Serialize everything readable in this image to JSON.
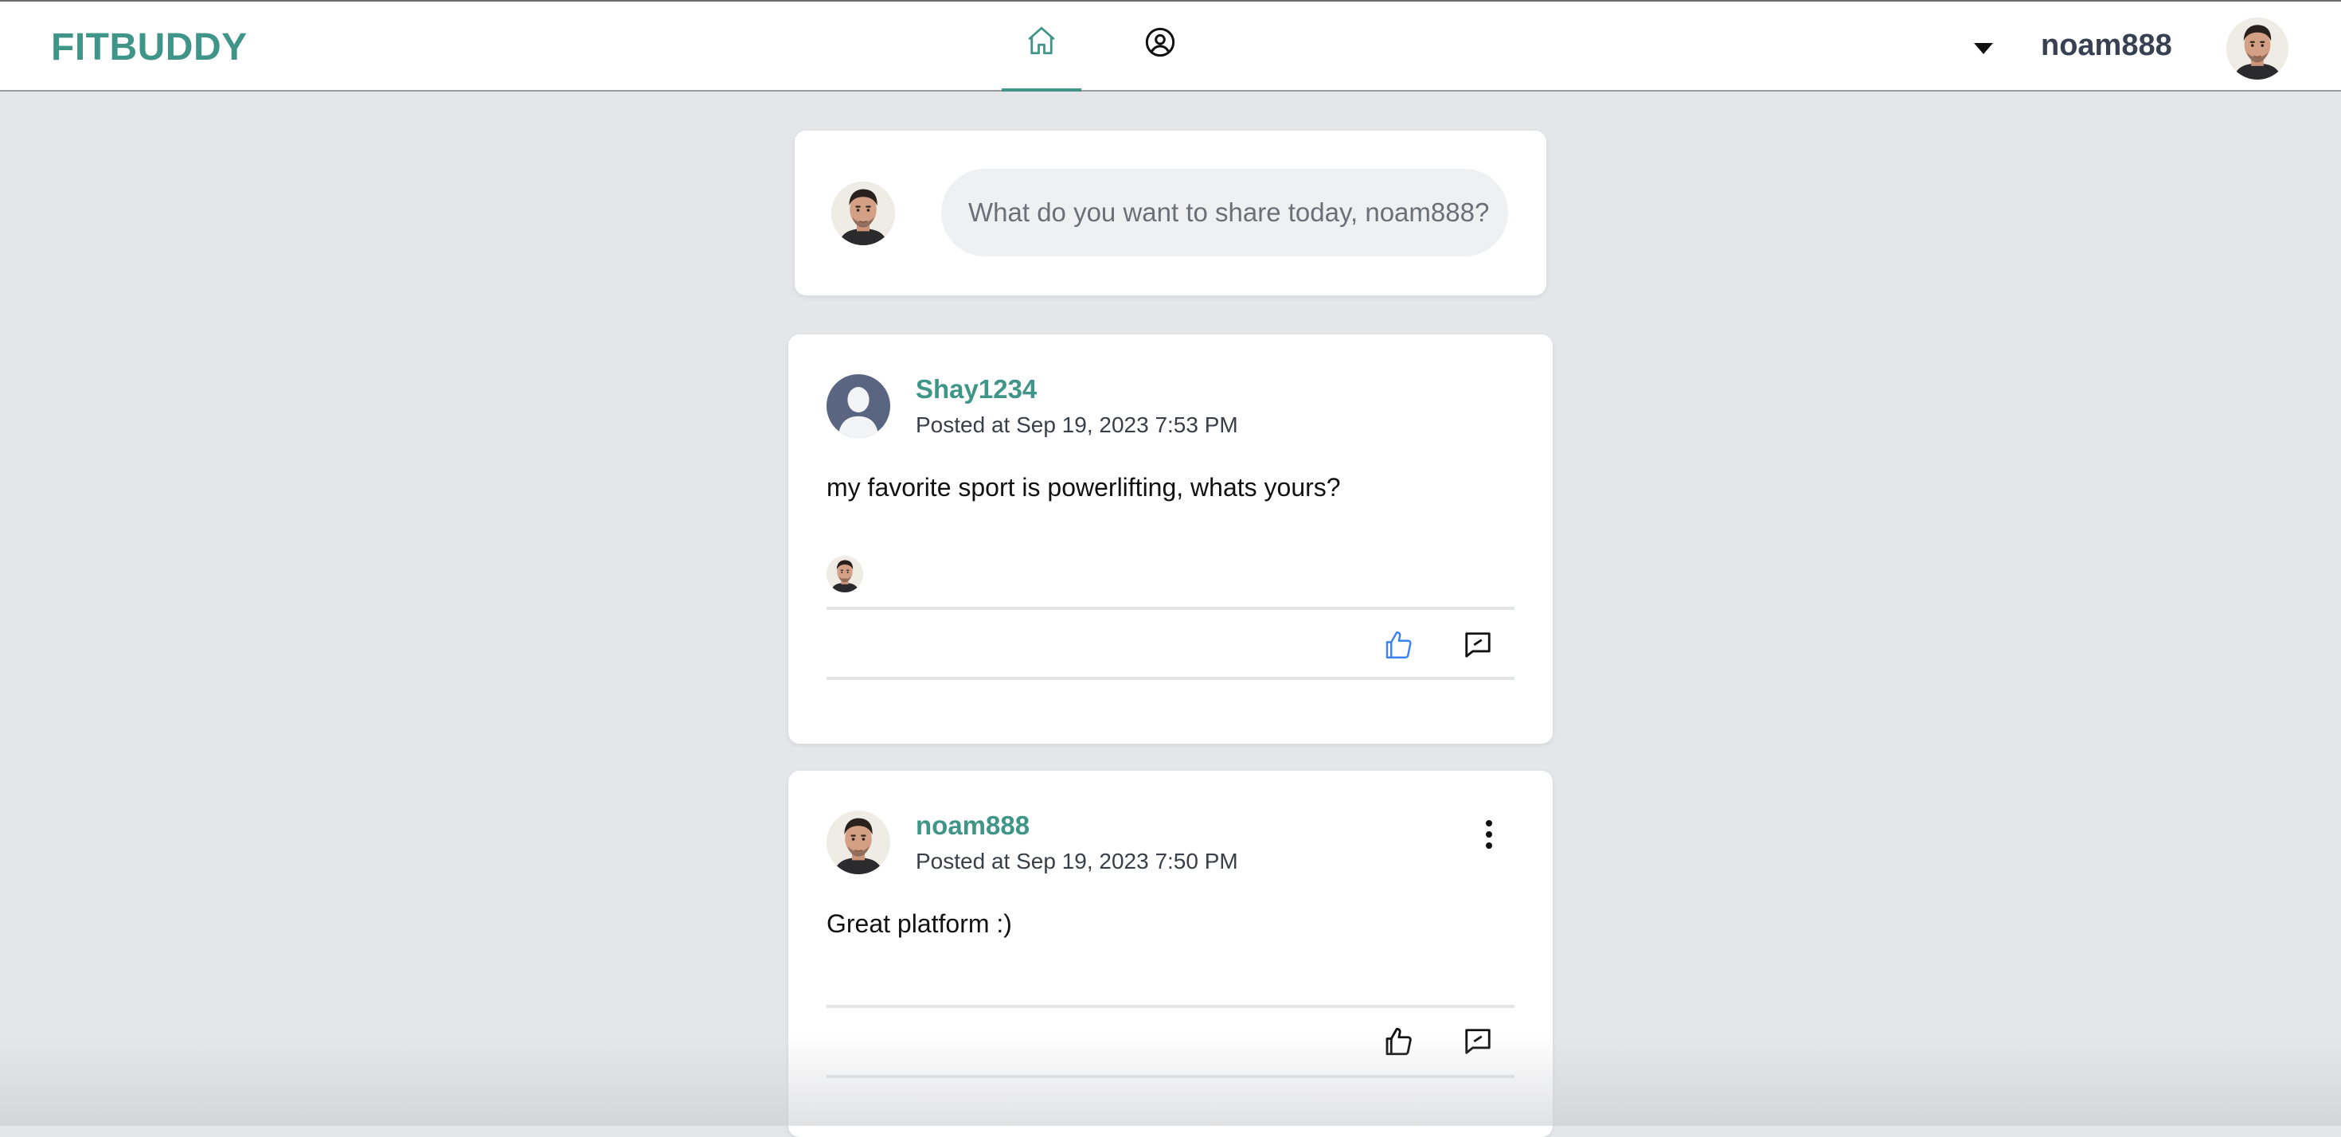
{
  "header": {
    "brand": "FITBUDDY",
    "nav": [
      {
        "name": "home",
        "icon": "home-icon",
        "active": true
      },
      {
        "name": "profile",
        "icon": "user-circle-icon",
        "active": false
      }
    ],
    "username": "noam888",
    "dropdown_icon": "caret-down-icon",
    "accent_color": "#3f9587"
  },
  "composer": {
    "placeholder": "What do you want to share today, noam888?"
  },
  "posts": [
    {
      "author": "Shay1234",
      "timestamp": "Posted at Sep 19, 2023 7:53 PM",
      "body": "my favorite sport is powerlifting, whats yours?",
      "avatar": "default-user-avatar",
      "liked_by_avatars": [
        "noam888"
      ],
      "like_icon": "thumbs-up-icon",
      "like_active": true,
      "comment_icon": "comment-icon"
    },
    {
      "author": "noam888",
      "timestamp": "Posted at Sep 19, 2023 7:50 PM",
      "body": "Great platform :)",
      "avatar": "user-photo-avatar",
      "menu_icon": "more-vertical-icon",
      "like_icon": "thumbs-up-icon",
      "like_active": false,
      "comment_icon": "comment-icon"
    }
  ]
}
